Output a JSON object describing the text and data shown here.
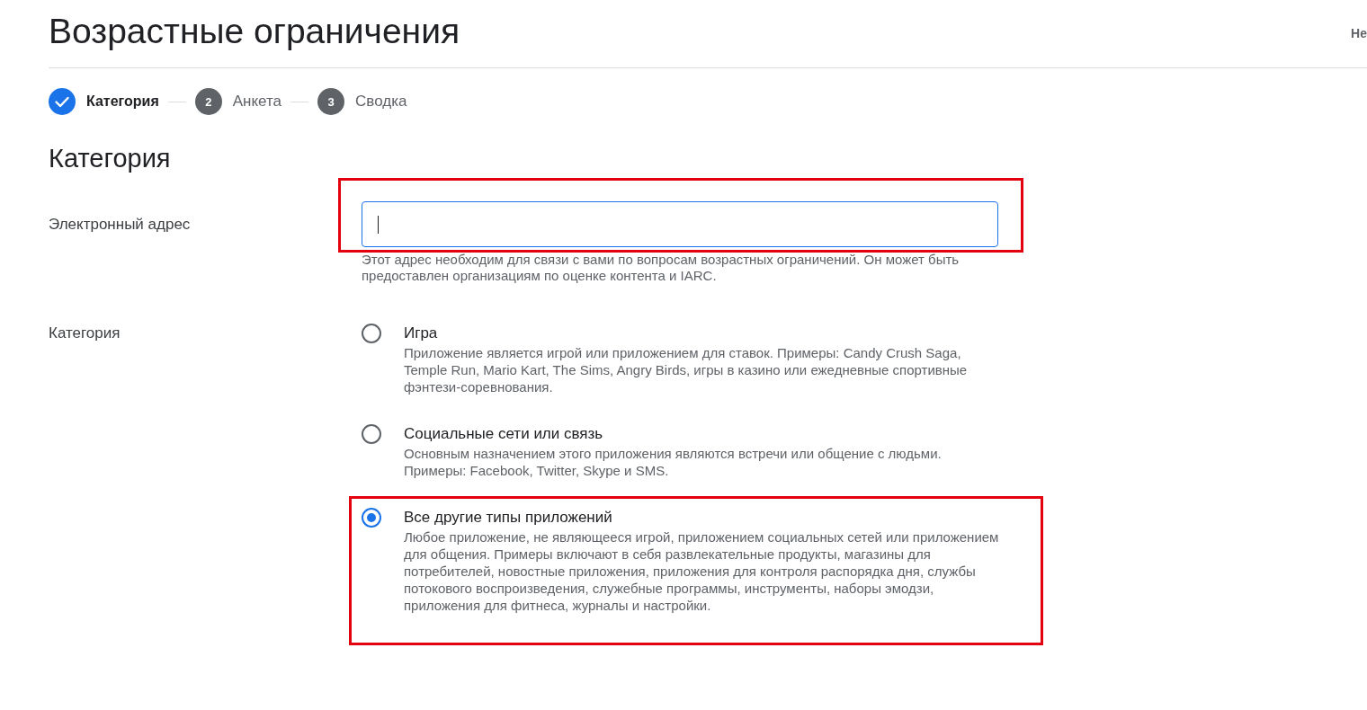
{
  "page": {
    "title": "Возрастные ограничения",
    "corner_text": "Не"
  },
  "steps": [
    {
      "label": "Категория",
      "completed": true,
      "selected": true
    },
    {
      "number": "2",
      "label": "Анкета",
      "completed": false,
      "selected": false
    },
    {
      "number": "3",
      "label": "Сводка",
      "completed": false,
      "selected": false
    }
  ],
  "section_title": "Категория",
  "email": {
    "label": "Электронный адрес",
    "focused": true,
    "helper_text": "Этот адрес необходим для связи с вами по вопросам возрастных ограничений. Он может быть предоставлен организациям по оценке контента и IARC.",
    "highlighted": true
  },
  "category": {
    "label": "Категория",
    "options": [
      {
        "title": "Игра",
        "description": "Приложение является игрой или приложением для ставок. Примеры: Candy Crush Saga, Temple Run, Mario Kart, The Sims, Angry Birds, игры в казино или ежедневные спортивные фэнтези-соревнования.",
        "selected": false,
        "highlighted": false
      },
      {
        "title": "Социальные сети или связь",
        "description": "Основным назначением этого приложения являются встречи или общение с людьми. Примеры: Facebook, Twitter, Skype и SMS.",
        "selected": false,
        "highlighted": false
      },
      {
        "title": "Все другие типы приложений",
        "description": "Любое приложение, не являющееся игрой, приложением социальных сетей или приложением для общения. Примеры включают в себя развлекательные продукты, магазины для потребителей, новостные приложения, приложения для контроля распорядка дня, службы потокового воспроизведения, служебные программы, инструменты, наборы эмодзи, приложения для фитнеса, журналы и настройки.",
        "selected": true,
        "highlighted": true
      }
    ]
  }
}
